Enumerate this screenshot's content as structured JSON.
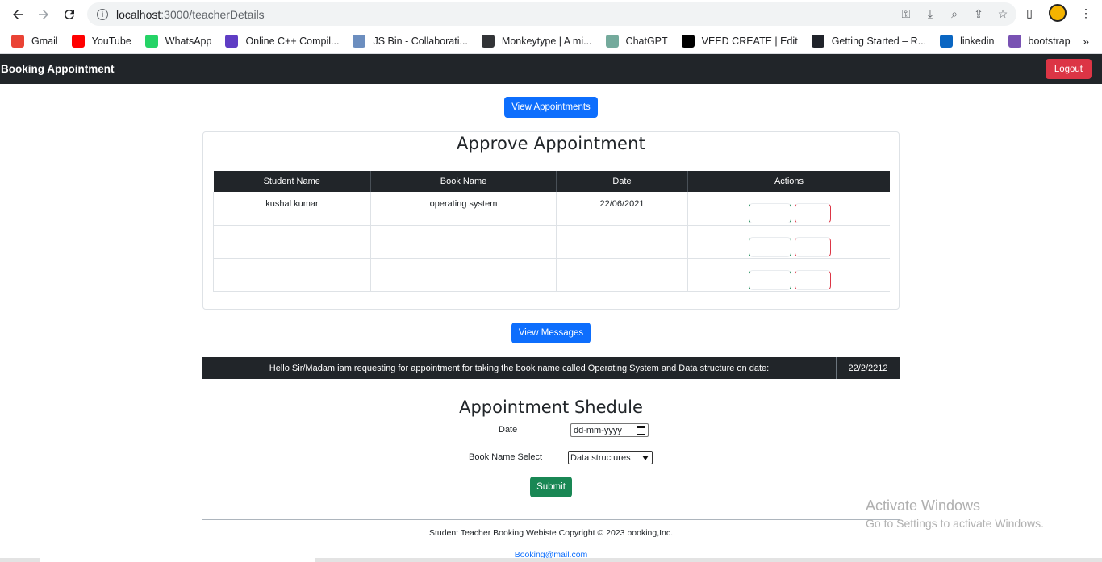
{
  "browser": {
    "url_host": "localhost",
    "url_rest": ":3000/teacherDetails",
    "bookmarks": [
      {
        "label": "Gmail",
        "icon": "gmail-icon",
        "color": "#ea4335"
      },
      {
        "label": "YouTube",
        "icon": "youtube-icon",
        "color": "#ff0000"
      },
      {
        "label": "WhatsApp",
        "icon": "whatsapp-icon",
        "color": "#25d366"
      },
      {
        "label": "Online C++ Compil...",
        "icon": "compiler-icon",
        "color": "#5f3dc4"
      },
      {
        "label": "JS Bin - Collaborati...",
        "icon": "jsbin-icon",
        "color": "#6c8ebf"
      },
      {
        "label": "Monkeytype | A mi...",
        "icon": "monkeytype-icon",
        "color": "#323437"
      },
      {
        "label": "ChatGPT",
        "icon": "chatgpt-icon",
        "color": "#74aa9c"
      },
      {
        "label": "VEED CREATE | Edit",
        "icon": "veed-icon",
        "color": "#000000"
      },
      {
        "label": "Getting Started – R...",
        "icon": "react-icon",
        "color": "#20232a"
      },
      {
        "label": "linkedin",
        "icon": "linkedin-icon",
        "color": "#0a66c2"
      },
      {
        "label": "bootstrap",
        "icon": "bootstrap-icon",
        "color": "#7952b3"
      }
    ]
  },
  "navbar": {
    "brand": "Booking Appointment",
    "logout_label": "Logout"
  },
  "view_appointments_label": "View Appointments",
  "approve": {
    "title": "Approve Appointment",
    "headers": [
      "Student Name",
      "Book Name",
      "Date",
      "Actions"
    ],
    "rows": [
      {
        "student": "kushal kumar",
        "book": "operating system",
        "date": "22/06/2021"
      },
      {
        "student": "",
        "book": "",
        "date": ""
      },
      {
        "student": "",
        "book": "",
        "date": ""
      }
    ]
  },
  "view_messages_label": "View Messages",
  "message": {
    "text": "Hello Sir/Madam iam requesting for appointment for taking the book name called Operating System and Data structure on date:",
    "date": "22/2/2212"
  },
  "schedule": {
    "title": "Appointment Shedule",
    "date_label": "Date",
    "date_placeholder": "dd-mm-yyyy",
    "book_label": "Book Name Select",
    "book_selected": "Data structures",
    "submit_label": "Submit"
  },
  "footer": {
    "copyright": "Student Teacher Booking Webiste Copyright © 2023 booking,Inc.",
    "email": "Booking@mail.com"
  },
  "windows": {
    "line1": "Activate Windows",
    "line2": "Go to Settings to activate Windows."
  },
  "colors": {
    "dark": "#212529",
    "primary": "#0d6efd",
    "danger": "#dc3545",
    "success": "#198754"
  }
}
